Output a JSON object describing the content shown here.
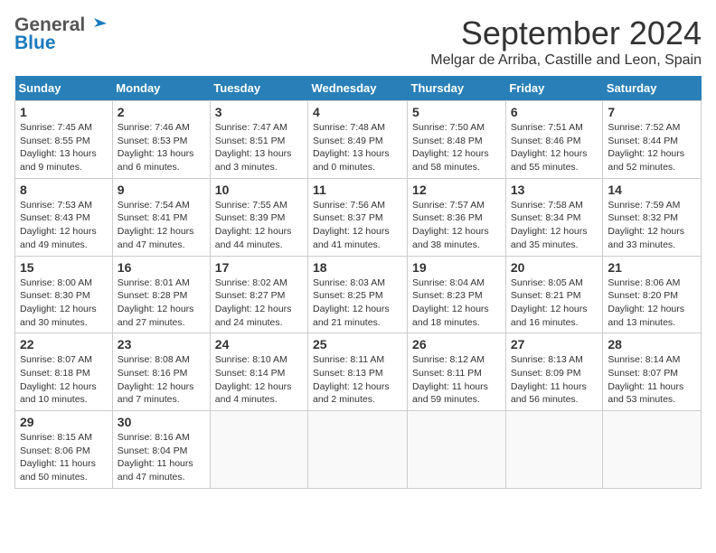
{
  "header": {
    "month_title": "September 2024",
    "location": "Melgar de Arriba, Castille and Leon, Spain",
    "logo_general": "General",
    "logo_blue": "Blue"
  },
  "weekdays": [
    "Sunday",
    "Monday",
    "Tuesday",
    "Wednesday",
    "Thursday",
    "Friday",
    "Saturday"
  ],
  "weeks": [
    [
      {
        "day": "1",
        "sunrise": "Sunrise: 7:45 AM",
        "sunset": "Sunset: 8:55 PM",
        "daylight": "Daylight: 13 hours and 9 minutes."
      },
      {
        "day": "2",
        "sunrise": "Sunrise: 7:46 AM",
        "sunset": "Sunset: 8:53 PM",
        "daylight": "Daylight: 13 hours and 6 minutes."
      },
      {
        "day": "3",
        "sunrise": "Sunrise: 7:47 AM",
        "sunset": "Sunset: 8:51 PM",
        "daylight": "Daylight: 13 hours and 3 minutes."
      },
      {
        "day": "4",
        "sunrise": "Sunrise: 7:48 AM",
        "sunset": "Sunset: 8:49 PM",
        "daylight": "Daylight: 13 hours and 0 minutes."
      },
      {
        "day": "5",
        "sunrise": "Sunrise: 7:50 AM",
        "sunset": "Sunset: 8:48 PM",
        "daylight": "Daylight: 12 hours and 58 minutes."
      },
      {
        "day": "6",
        "sunrise": "Sunrise: 7:51 AM",
        "sunset": "Sunset: 8:46 PM",
        "daylight": "Daylight: 12 hours and 55 minutes."
      },
      {
        "day": "7",
        "sunrise": "Sunrise: 7:52 AM",
        "sunset": "Sunset: 8:44 PM",
        "daylight": "Daylight: 12 hours and 52 minutes."
      }
    ],
    [
      {
        "day": "8",
        "sunrise": "Sunrise: 7:53 AM",
        "sunset": "Sunset: 8:43 PM",
        "daylight": "Daylight: 12 hours and 49 minutes."
      },
      {
        "day": "9",
        "sunrise": "Sunrise: 7:54 AM",
        "sunset": "Sunset: 8:41 PM",
        "daylight": "Daylight: 12 hours and 47 minutes."
      },
      {
        "day": "10",
        "sunrise": "Sunrise: 7:55 AM",
        "sunset": "Sunset: 8:39 PM",
        "daylight": "Daylight: 12 hours and 44 minutes."
      },
      {
        "day": "11",
        "sunrise": "Sunrise: 7:56 AM",
        "sunset": "Sunset: 8:37 PM",
        "daylight": "Daylight: 12 hours and 41 minutes."
      },
      {
        "day": "12",
        "sunrise": "Sunrise: 7:57 AM",
        "sunset": "Sunset: 8:36 PM",
        "daylight": "Daylight: 12 hours and 38 minutes."
      },
      {
        "day": "13",
        "sunrise": "Sunrise: 7:58 AM",
        "sunset": "Sunset: 8:34 PM",
        "daylight": "Daylight: 12 hours and 35 minutes."
      },
      {
        "day": "14",
        "sunrise": "Sunrise: 7:59 AM",
        "sunset": "Sunset: 8:32 PM",
        "daylight": "Daylight: 12 hours and 33 minutes."
      }
    ],
    [
      {
        "day": "15",
        "sunrise": "Sunrise: 8:00 AM",
        "sunset": "Sunset: 8:30 PM",
        "daylight": "Daylight: 12 hours and 30 minutes."
      },
      {
        "day": "16",
        "sunrise": "Sunrise: 8:01 AM",
        "sunset": "Sunset: 8:28 PM",
        "daylight": "Daylight: 12 hours and 27 minutes."
      },
      {
        "day": "17",
        "sunrise": "Sunrise: 8:02 AM",
        "sunset": "Sunset: 8:27 PM",
        "daylight": "Daylight: 12 hours and 24 minutes."
      },
      {
        "day": "18",
        "sunrise": "Sunrise: 8:03 AM",
        "sunset": "Sunset: 8:25 PM",
        "daylight": "Daylight: 12 hours and 21 minutes."
      },
      {
        "day": "19",
        "sunrise": "Sunrise: 8:04 AM",
        "sunset": "Sunset: 8:23 PM",
        "daylight": "Daylight: 12 hours and 18 minutes."
      },
      {
        "day": "20",
        "sunrise": "Sunrise: 8:05 AM",
        "sunset": "Sunset: 8:21 PM",
        "daylight": "Daylight: 12 hours and 16 minutes."
      },
      {
        "day": "21",
        "sunrise": "Sunrise: 8:06 AM",
        "sunset": "Sunset: 8:20 PM",
        "daylight": "Daylight: 12 hours and 13 minutes."
      }
    ],
    [
      {
        "day": "22",
        "sunrise": "Sunrise: 8:07 AM",
        "sunset": "Sunset: 8:18 PM",
        "daylight": "Daylight: 12 hours and 10 minutes."
      },
      {
        "day": "23",
        "sunrise": "Sunrise: 8:08 AM",
        "sunset": "Sunset: 8:16 PM",
        "daylight": "Daylight: 12 hours and 7 minutes."
      },
      {
        "day": "24",
        "sunrise": "Sunrise: 8:10 AM",
        "sunset": "Sunset: 8:14 PM",
        "daylight": "Daylight: 12 hours and 4 minutes."
      },
      {
        "day": "25",
        "sunrise": "Sunrise: 8:11 AM",
        "sunset": "Sunset: 8:13 PM",
        "daylight": "Daylight: 12 hours and 2 minutes."
      },
      {
        "day": "26",
        "sunrise": "Sunrise: 8:12 AM",
        "sunset": "Sunset: 8:11 PM",
        "daylight": "Daylight: 11 hours and 59 minutes."
      },
      {
        "day": "27",
        "sunrise": "Sunrise: 8:13 AM",
        "sunset": "Sunset: 8:09 PM",
        "daylight": "Daylight: 11 hours and 56 minutes."
      },
      {
        "day": "28",
        "sunrise": "Sunrise: 8:14 AM",
        "sunset": "Sunset: 8:07 PM",
        "daylight": "Daylight: 11 hours and 53 minutes."
      }
    ],
    [
      {
        "day": "29",
        "sunrise": "Sunrise: 8:15 AM",
        "sunset": "Sunset: 8:06 PM",
        "daylight": "Daylight: 11 hours and 50 minutes."
      },
      {
        "day": "30",
        "sunrise": "Sunrise: 8:16 AM",
        "sunset": "Sunset: 8:04 PM",
        "daylight": "Daylight: 11 hours and 47 minutes."
      },
      null,
      null,
      null,
      null,
      null
    ]
  ]
}
